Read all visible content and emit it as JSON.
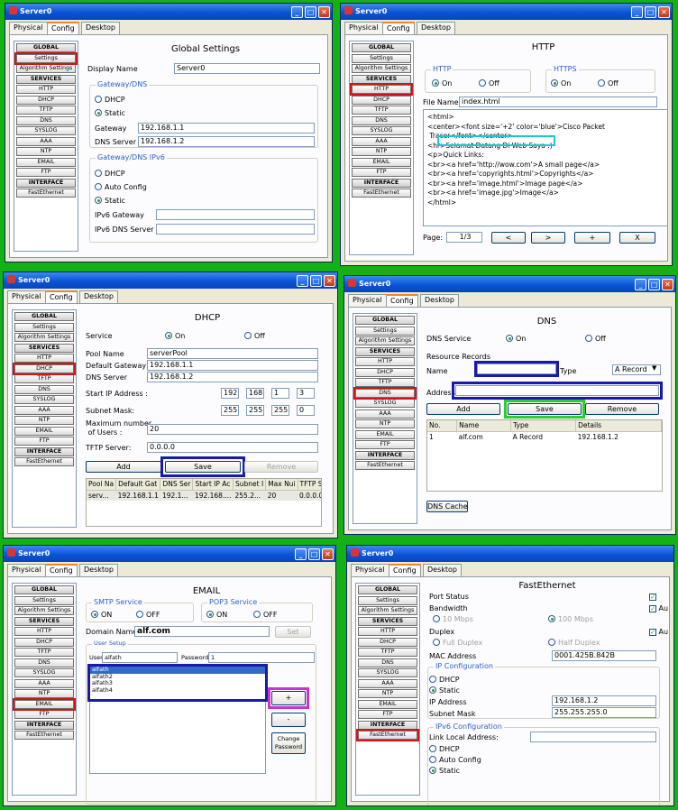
{
  "window_title": "Server0",
  "tabs": [
    "Physical",
    "Config",
    "Desktop"
  ],
  "sidebar": [
    "GLOBAL",
    "Settings",
    "Algorithm Settings",
    "SERVICES",
    "HTTP",
    "DHCP",
    "TFTP",
    "DNS",
    "SYSLOG",
    "AAA",
    "NTP",
    "EMAIL",
    "FTP",
    "INTERFACE",
    "FastEthernet"
  ],
  "p1": {
    "title": "Global Settings",
    "display_name_label": "Display Name",
    "display_name": "Server0",
    "gw_group": "Gateway/DNS",
    "dhcp": "DHCP",
    "static": "Static",
    "gateway_label": "Gateway",
    "gateway": "192.168.1.1",
    "dns_label": "DNS Server",
    "dns": "192.168.1.2",
    "v6_group": "Gateway/DNS IPv6",
    "auto": "Auto Config",
    "v6gw_label": "IPv6 Gateway",
    "v6dns_label": "IPv6 DNS Server"
  },
  "p2": {
    "title": "HTTP",
    "http": "HTTP",
    "https": "HTTPS",
    "on": "On",
    "off": "Off",
    "file_label": "File Name:",
    "file": "index.html",
    "code": [
      "<html>",
      "<center><font size='+2' color='blue'>Cisco Packet",
      " Tracer</font></center>",
      "<hr>Selamat Datang Di Web Saya :)",
      "<p>Quick Links:",
      "<br><a href='http://wow.com'>A small page</a>",
      "<br><a href='copyrights.html'>Copyrights</a>",
      "<br><a href='image.html'>Image page</a>",
      "<br><a href='image.jpg'>Image</a>",
      "</html>"
    ],
    "page_label": "Page:",
    "page": "1/3",
    "prev": "<",
    "next": ">",
    "plus": "+",
    "close": "X"
  },
  "p3": {
    "title": "DHCP",
    "service": "Service",
    "on": "On",
    "off": "Off",
    "pool_label": "Pool Name",
    "pool": "serverPool",
    "dg_label": "Default Gateway",
    "dg": "192.168.1.1",
    "dns_label": "DNS Server",
    "dns": "192.168.1.2",
    "start_label": "Start IP Address :",
    "start": [
      "192",
      "168",
      "1",
      "3"
    ],
    "mask_label": "Subnet Mask:",
    "mask": [
      "255",
      "255",
      "255",
      "0"
    ],
    "max_label1": "Maximum number",
    "max_label2": "of Users :",
    "max": "20",
    "tftp_label": "TFTP Server:",
    "tftp": "0.0.0.0",
    "add": "Add",
    "save": "Save",
    "remove": "Remove",
    "cols": [
      "Pool Na",
      "Default Gat",
      "DNS Ser",
      "Start IP Ac",
      "Subnet I",
      "Max Nui",
      "TFTP S"
    ],
    "row": [
      "serv...",
      "192.168.1.1",
      "192.1...",
      "192.168....",
      "255.2...",
      "20",
      "0.0.0.0"
    ]
  },
  "p4": {
    "title": "DNS",
    "service": "DNS Service",
    "on": "On",
    "off": "Off",
    "rr": "Resource Records",
    "name_label": "Name",
    "type_label": "Type",
    "type": "A Record",
    "addr_label": "Address",
    "add": "Add",
    "save": "Save",
    "remove": "Remove",
    "cols": [
      "No.",
      "Name",
      "Type",
      "Details"
    ],
    "row": [
      "1",
      "alf.com",
      "A Record",
      "192.168.1.2"
    ],
    "cache": "DNS Cache"
  },
  "p5": {
    "title": "EMAIL",
    "smtp": "SMTP Service",
    "pop": "POP3 Service",
    "on": "ON",
    "off": "OFF",
    "domain_label": "Domain Name:",
    "domain": "alf.com",
    "set": "Set",
    "us": "User Setup",
    "user_label": "User",
    "user": "alfath",
    "pw_label": "Password",
    "pw": "1",
    "users": [
      "alfath",
      "alfath2",
      "alfath3",
      "alfath4"
    ],
    "plus": "+",
    "minus": "-",
    "change": [
      "Change",
      "Password"
    ]
  },
  "p6": {
    "title": "FastEthernet",
    "status_label": "Port Status",
    "bw_label": "Bandwidth",
    "b10": "10 Mbps",
    "b100": "100 Mbps",
    "auto": "Au",
    "duplex_label": "Duplex",
    "full": "Full Duplex",
    "half": "Half Duplex",
    "mac_label": "MAC Address",
    "mac": "0001.425B.842B",
    "ipc": "IP Configuration",
    "dhcp": "DHCP",
    "static": "Static",
    "ip_label": "IP Address",
    "ip": "192.168.1.2",
    "mask_label": "Subnet Mask",
    "mask": "255.255.255.0",
    "v6": "IPv6 Configuration",
    "lla": "Link Local Address:",
    "autoc": "Auto Config"
  },
  "colors": {
    "highlight_red": "#d41414",
    "highlight_blue": "#1a1aa8",
    "highlight_green": "#2ecc2e",
    "highlight_cyan": "#18c8d8",
    "highlight_magenta": "#cc33cc",
    "background": "#13b113"
  }
}
